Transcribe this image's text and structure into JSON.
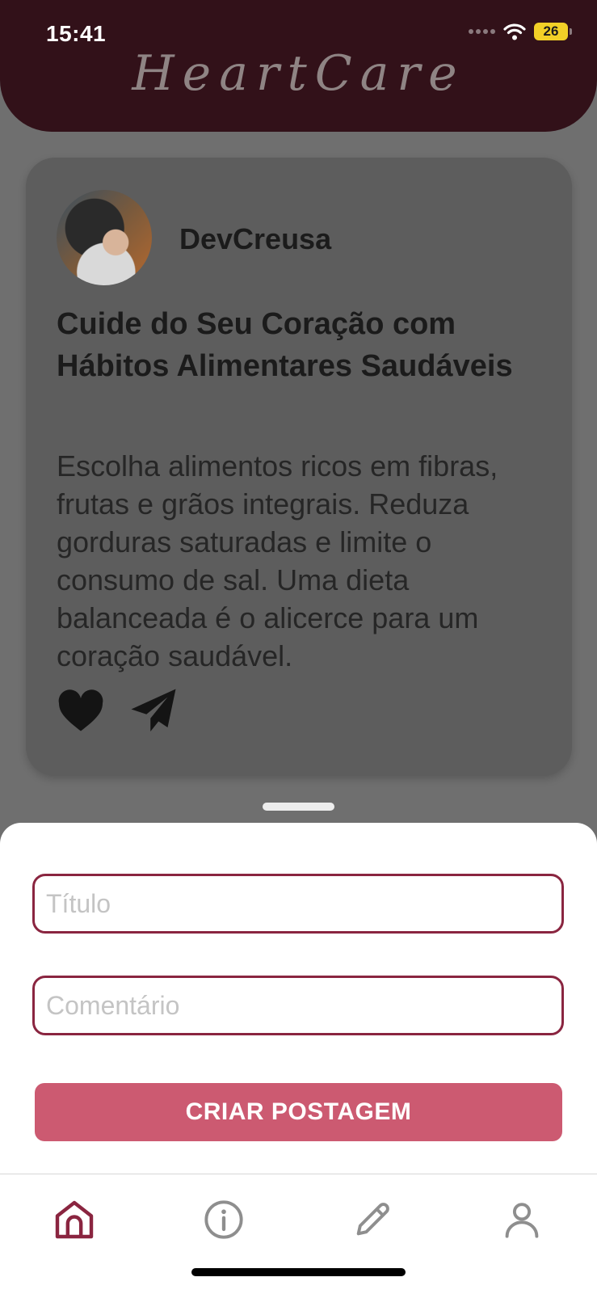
{
  "status_bar": {
    "time": "15:41",
    "battery": "26"
  },
  "header": {
    "brand": "HeartCare"
  },
  "post": {
    "author": "DevCreusa",
    "title": "Cuide do Seu Coração com Hábitos Alimentares Saudáveis",
    "body": "Escolha alimentos ricos em fibras, frutas e grãos integrais. Reduza gorduras saturadas e limite o consumo de sal. Uma dieta balanceada é o alicerce para um coração saudável.",
    "actions": [
      {
        "icon": "heart-icon"
      },
      {
        "icon": "send-icon"
      }
    ]
  },
  "form": {
    "title_placeholder": "Título",
    "title_value": "",
    "comment_placeholder": "Comentário",
    "comment_value": "",
    "submit_label": "CRIAR POSTAGEM"
  },
  "tabbar": {
    "items": [
      {
        "icon": "home-icon",
        "active": true
      },
      {
        "icon": "info-icon",
        "active": false
      },
      {
        "icon": "pencil-icon",
        "active": false
      },
      {
        "icon": "user-icon",
        "active": false
      }
    ]
  },
  "colors": {
    "header_bg": "#321119",
    "accent": "#8a2540",
    "button": "#cc5a71",
    "inactive_icon": "#8e8e8e"
  }
}
